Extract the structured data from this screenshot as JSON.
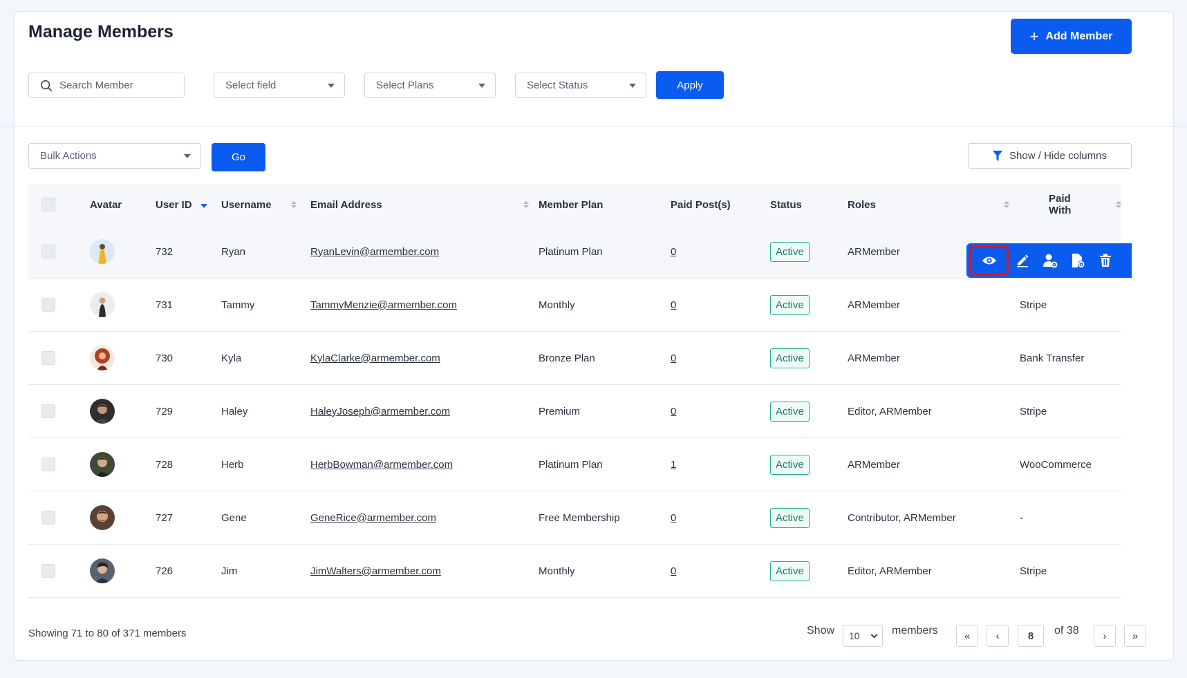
{
  "header": {
    "title": "Manage Members",
    "add_button": "Add Member"
  },
  "filters": {
    "search_placeholder": "Search Member",
    "field_select": "Select field",
    "plans_select": "Select Plans",
    "status_select": "Select Status",
    "apply": "Apply"
  },
  "toolbar": {
    "bulk_actions": "Bulk Actions",
    "go": "Go",
    "columns_toggle": "Show / Hide columns"
  },
  "table": {
    "columns": {
      "avatar": "Avatar",
      "user_id": "User ID",
      "username": "Username",
      "email": "Email Address",
      "plan": "Member Plan",
      "paid_posts": "Paid Post(s)",
      "status": "Status",
      "roles": "Roles",
      "paid_with": "Paid With"
    },
    "rows": [
      {
        "id": "732",
        "username": "Ryan",
        "email": "RyanLevin@armember.com",
        "plan": "Platinum Plan",
        "paid_posts": "0",
        "status": "Active",
        "roles": "ARMember",
        "paid_with": ""
      },
      {
        "id": "731",
        "username": "Tammy",
        "email": "TammyMenzie@armember.com",
        "plan": "Monthly",
        "paid_posts": "0",
        "status": "Active",
        "roles": "ARMember",
        "paid_with": "Stripe"
      },
      {
        "id": "730",
        "username": "Kyla",
        "email": "KylaClarke@armember.com",
        "plan": "Bronze Plan",
        "paid_posts": "0",
        "status": "Active",
        "roles": "ARMember",
        "paid_with": "Bank Transfer"
      },
      {
        "id": "729",
        "username": "Haley",
        "email": "HaleyJoseph@armember.com",
        "plan": "Premium",
        "paid_posts": "0",
        "status": "Active",
        "roles": "Editor, ARMember",
        "paid_with": "Stripe"
      },
      {
        "id": "728",
        "username": "Herb",
        "email": "HerbBowman@armember.com",
        "plan": "Platinum Plan",
        "paid_posts": "1",
        "status": "Active",
        "roles": "ARMember",
        "paid_with": "WooCommerce"
      },
      {
        "id": "727",
        "username": "Gene",
        "email": "GeneRice@armember.com",
        "plan": "Free Membership",
        "paid_posts": "0",
        "status": "Active",
        "roles": "Contributor, ARMember",
        "paid_with": "-"
      },
      {
        "id": "726",
        "username": "Jim",
        "email": "JimWalters@armember.com",
        "plan": "Monthly",
        "paid_posts": "0",
        "status": "Active",
        "roles": "Editor, ARMember",
        "paid_with": "Stripe"
      }
    ]
  },
  "row_actions": [
    "view-icon",
    "edit-icon",
    "user-settings-icon",
    "document-settings-icon",
    "trash-icon"
  ],
  "footer": {
    "showing": "Showing 71 to 80 of 371 members",
    "show_label": "Show",
    "per_page": "10",
    "members_label": "members",
    "first": "«",
    "prev": "‹",
    "current_page": "8",
    "of_pages": "of 38",
    "next": "›",
    "last": "»"
  },
  "colors": {
    "primary": "#0a5cf0",
    "active_badge": "#25b08c",
    "highlight": "#e0141e"
  }
}
